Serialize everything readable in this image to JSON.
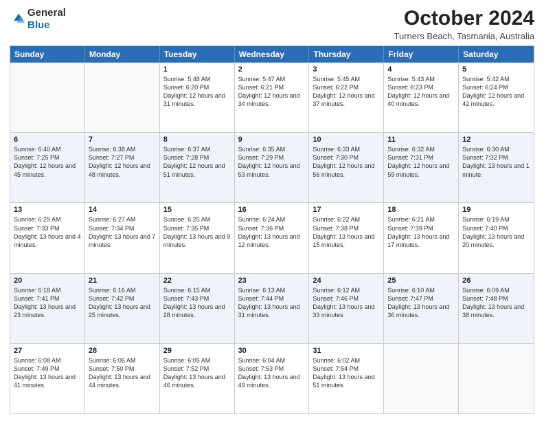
{
  "header": {
    "logo_general": "General",
    "logo_blue": "Blue",
    "title": "October 2024",
    "location": "Turners Beach, Tasmania, Australia"
  },
  "days_of_week": [
    "Sunday",
    "Monday",
    "Tuesday",
    "Wednesday",
    "Thursday",
    "Friday",
    "Saturday"
  ],
  "weeks": [
    [
      {
        "day": "",
        "sunrise": "",
        "sunset": "",
        "daylight": ""
      },
      {
        "day": "",
        "sunrise": "",
        "sunset": "",
        "daylight": ""
      },
      {
        "day": "1",
        "sunrise": "Sunrise: 5:48 AM",
        "sunset": "Sunset: 6:20 PM",
        "daylight": "Daylight: 12 hours and 31 minutes."
      },
      {
        "day": "2",
        "sunrise": "Sunrise: 5:47 AM",
        "sunset": "Sunset: 6:21 PM",
        "daylight": "Daylight: 12 hours and 34 minutes."
      },
      {
        "day": "3",
        "sunrise": "Sunrise: 5:45 AM",
        "sunset": "Sunset: 6:22 PM",
        "daylight": "Daylight: 12 hours and 37 minutes."
      },
      {
        "day": "4",
        "sunrise": "Sunrise: 5:43 AM",
        "sunset": "Sunset: 6:23 PM",
        "daylight": "Daylight: 12 hours and 40 minutes."
      },
      {
        "day": "5",
        "sunrise": "Sunrise: 5:42 AM",
        "sunset": "Sunset: 6:24 PM",
        "daylight": "Daylight: 12 hours and 42 minutes."
      }
    ],
    [
      {
        "day": "6",
        "sunrise": "Sunrise: 6:40 AM",
        "sunset": "Sunset: 7:25 PM",
        "daylight": "Daylight: 12 hours and 45 minutes."
      },
      {
        "day": "7",
        "sunrise": "Sunrise: 6:38 AM",
        "sunset": "Sunset: 7:27 PM",
        "daylight": "Daylight: 12 hours and 48 minutes."
      },
      {
        "day": "8",
        "sunrise": "Sunrise: 6:37 AM",
        "sunset": "Sunset: 7:28 PM",
        "daylight": "Daylight: 12 hours and 51 minutes."
      },
      {
        "day": "9",
        "sunrise": "Sunrise: 6:35 AM",
        "sunset": "Sunset: 7:29 PM",
        "daylight": "Daylight: 12 hours and 53 minutes."
      },
      {
        "day": "10",
        "sunrise": "Sunrise: 6:33 AM",
        "sunset": "Sunset: 7:30 PM",
        "daylight": "Daylight: 12 hours and 56 minutes."
      },
      {
        "day": "11",
        "sunrise": "Sunrise: 6:32 AM",
        "sunset": "Sunset: 7:31 PM",
        "daylight": "Daylight: 12 hours and 59 minutes."
      },
      {
        "day": "12",
        "sunrise": "Sunrise: 6:30 AM",
        "sunset": "Sunset: 7:32 PM",
        "daylight": "Daylight: 13 hours and 1 minute."
      }
    ],
    [
      {
        "day": "13",
        "sunrise": "Sunrise: 6:29 AM",
        "sunset": "Sunset: 7:33 PM",
        "daylight": "Daylight: 13 hours and 4 minutes."
      },
      {
        "day": "14",
        "sunrise": "Sunrise: 6:27 AM",
        "sunset": "Sunset: 7:34 PM",
        "daylight": "Daylight: 13 hours and 7 minutes."
      },
      {
        "day": "15",
        "sunrise": "Sunrise: 6:25 AM",
        "sunset": "Sunset: 7:35 PM",
        "daylight": "Daylight: 13 hours and 9 minutes."
      },
      {
        "day": "16",
        "sunrise": "Sunrise: 6:24 AM",
        "sunset": "Sunset: 7:36 PM",
        "daylight": "Daylight: 13 hours and 12 minutes."
      },
      {
        "day": "17",
        "sunrise": "Sunrise: 6:22 AM",
        "sunset": "Sunset: 7:38 PM",
        "daylight": "Daylight: 13 hours and 15 minutes."
      },
      {
        "day": "18",
        "sunrise": "Sunrise: 6:21 AM",
        "sunset": "Sunset: 7:39 PM",
        "daylight": "Daylight: 13 hours and 17 minutes."
      },
      {
        "day": "19",
        "sunrise": "Sunrise: 6:19 AM",
        "sunset": "Sunset: 7:40 PM",
        "daylight": "Daylight: 13 hours and 20 minutes."
      }
    ],
    [
      {
        "day": "20",
        "sunrise": "Sunrise: 6:18 AM",
        "sunset": "Sunset: 7:41 PM",
        "daylight": "Daylight: 13 hours and 23 minutes."
      },
      {
        "day": "21",
        "sunrise": "Sunrise: 6:16 AM",
        "sunset": "Sunset: 7:42 PM",
        "daylight": "Daylight: 13 hours and 25 minutes."
      },
      {
        "day": "22",
        "sunrise": "Sunrise: 6:15 AM",
        "sunset": "Sunset: 7:43 PM",
        "daylight": "Daylight: 13 hours and 28 minutes."
      },
      {
        "day": "23",
        "sunrise": "Sunrise: 6:13 AM",
        "sunset": "Sunset: 7:44 PM",
        "daylight": "Daylight: 13 hours and 31 minutes."
      },
      {
        "day": "24",
        "sunrise": "Sunrise: 6:12 AM",
        "sunset": "Sunset: 7:46 PM",
        "daylight": "Daylight: 13 hours and 33 minutes."
      },
      {
        "day": "25",
        "sunrise": "Sunrise: 6:10 AM",
        "sunset": "Sunset: 7:47 PM",
        "daylight": "Daylight: 13 hours and 36 minutes."
      },
      {
        "day": "26",
        "sunrise": "Sunrise: 6:09 AM",
        "sunset": "Sunset: 7:48 PM",
        "daylight": "Daylight: 13 hours and 38 minutes."
      }
    ],
    [
      {
        "day": "27",
        "sunrise": "Sunrise: 6:08 AM",
        "sunset": "Sunset: 7:49 PM",
        "daylight": "Daylight: 13 hours and 41 minutes."
      },
      {
        "day": "28",
        "sunrise": "Sunrise: 6:06 AM",
        "sunset": "Sunset: 7:50 PM",
        "daylight": "Daylight: 13 hours and 44 minutes."
      },
      {
        "day": "29",
        "sunrise": "Sunrise: 6:05 AM",
        "sunset": "Sunset: 7:52 PM",
        "daylight": "Daylight: 13 hours and 46 minutes."
      },
      {
        "day": "30",
        "sunrise": "Sunrise: 6:04 AM",
        "sunset": "Sunset: 7:53 PM",
        "daylight": "Daylight: 13 hours and 49 minutes."
      },
      {
        "day": "31",
        "sunrise": "Sunrise: 6:02 AM",
        "sunset": "Sunset: 7:54 PM",
        "daylight": "Daylight: 13 hours and 51 minutes."
      },
      {
        "day": "",
        "sunrise": "",
        "sunset": "",
        "daylight": ""
      },
      {
        "day": "",
        "sunrise": "",
        "sunset": "",
        "daylight": ""
      }
    ]
  ]
}
